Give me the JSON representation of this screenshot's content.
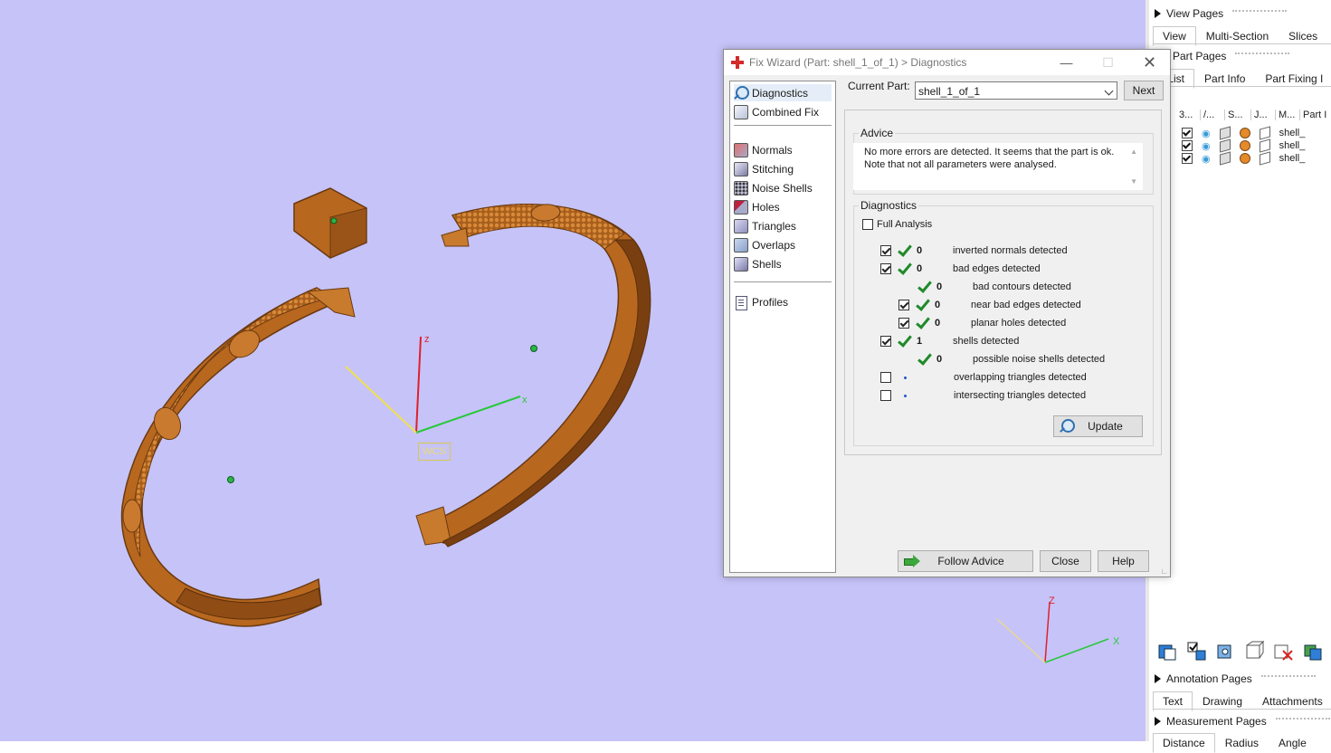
{
  "viewport": {
    "wcs_label": "WCS",
    "axis_x": "x",
    "axis_z": "z",
    "triad_x": "X",
    "triad_z": "Z"
  },
  "dialog": {
    "title": "Fix Wizard (Part: shell_1_of_1) > Diagnostics",
    "nav_items": [
      "Diagnostics",
      "Combined Fix",
      "Normals",
      "Stitching",
      "Noise Shells",
      "Holes",
      "Triangles",
      "Overlaps",
      "Shells",
      "Profiles"
    ],
    "current_part_label": "Current Part:",
    "current_part_value": "shell_1_of_1",
    "next_label": "Next",
    "advice_title": "Advice",
    "advice_line1": "No more errors are detected. It seems that the part is ok.",
    "advice_line2": "Note that not all parameters were analysed.",
    "diagnostics_title": "Diagnostics",
    "full_analysis_label": "Full Analysis",
    "rows": [
      {
        "count": "0",
        "label": "inverted normals detected"
      },
      {
        "count": "0",
        "label": "bad edges detected"
      },
      {
        "count": "0",
        "label": "bad contours detected"
      },
      {
        "count": "0",
        "label": "near bad edges detected"
      },
      {
        "count": "0",
        "label": "planar holes detected"
      },
      {
        "count": "1",
        "label": "shells detected"
      },
      {
        "count": "0",
        "label": "possible noise shells detected"
      },
      {
        "count": "",
        "label": "overlapping triangles detected"
      },
      {
        "count": "",
        "label": "intersecting triangles detected"
      }
    ],
    "update_label": "Update",
    "follow_advice_label": "Follow Advice",
    "close_label": "Close",
    "help_label": "Help"
  },
  "right_panel": {
    "view_pages": "View Pages",
    "view_tabs": [
      "View",
      "Multi-Section",
      "Slices"
    ],
    "part_pages": "Part Pages",
    "part_tabs": [
      "art List",
      "Part Info",
      "Part Fixing I"
    ],
    "list_headers": [
      "3...",
      "/...",
      "S...",
      "J...",
      "M...",
      "Part I"
    ],
    "rows": [
      "shell_",
      "shell_",
      "shell_"
    ],
    "annotation_pages": "Annotation Pages",
    "annotation_tabs": [
      "Text",
      "Drawing",
      "Attachments"
    ],
    "measurement_pages": "Measurement Pages",
    "measurement_tabs": [
      "Distance",
      "Radius",
      "Angle"
    ]
  }
}
